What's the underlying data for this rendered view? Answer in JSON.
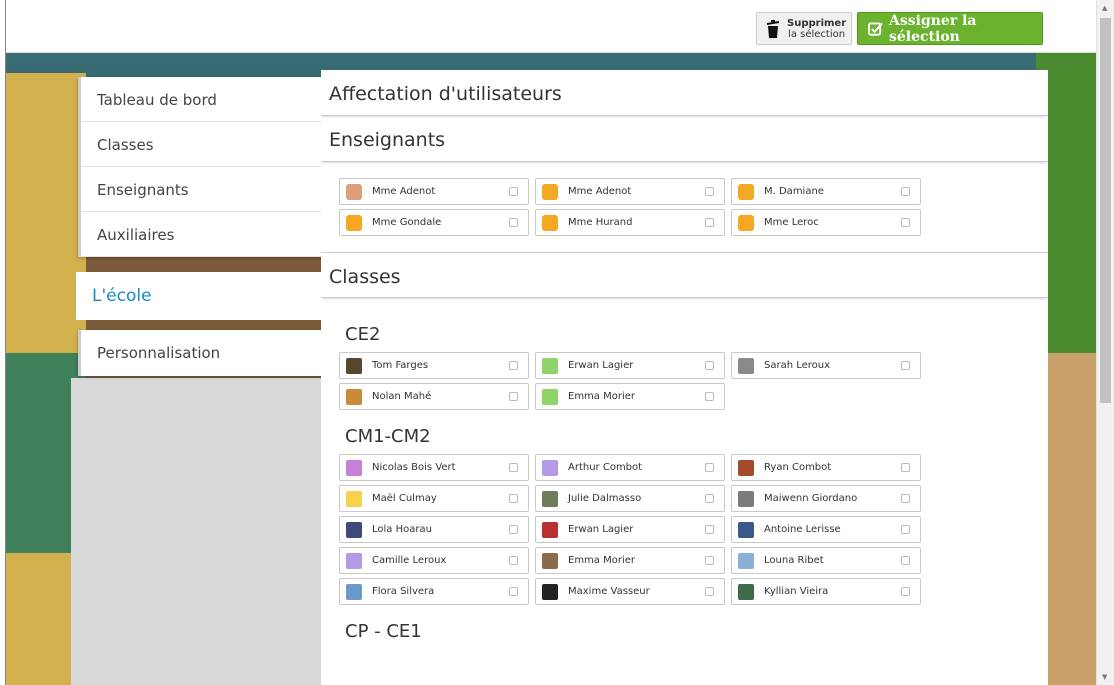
{
  "toolbar": {
    "delete_label_1": "Supprimer",
    "delete_label_2": "la sélection",
    "assign_label": "Assigner la sélection",
    "assign_color": "#6bb32f"
  },
  "sidebar": {
    "items": [
      {
        "label": "Tableau de bord"
      },
      {
        "label": "Classes"
      },
      {
        "label": "Enseignants"
      },
      {
        "label": "Auxiliaires"
      }
    ],
    "active": {
      "label": "L'école",
      "color": "#1a8ac4"
    },
    "perso": {
      "label": "Personnalisation"
    }
  },
  "main": {
    "title": "Affectation d'utilisateurs",
    "teachers_title": "Enseignants",
    "teachers": [
      {
        "name": "Mme Adenot",
        "icon": "avatar-girl"
      },
      {
        "name": "Mme Adenot",
        "icon": "avatar-default"
      },
      {
        "name": "M. Damiane",
        "icon": "avatar-default"
      },
      {
        "name": "Mme Gondale",
        "icon": "avatar-default"
      },
      {
        "name": "Mme Hurand",
        "icon": "avatar-default"
      },
      {
        "name": "Mme Leroc",
        "icon": "avatar-default"
      }
    ],
    "classes_title": "Classes",
    "classes": [
      {
        "name": "CE2",
        "students": [
          {
            "name": "Tom Farges",
            "color": "#5a4630"
          },
          {
            "name": "Erwan Lagier",
            "color": "#8fd46a"
          },
          {
            "name": "Sarah Leroux",
            "color": "#8a8a8a"
          },
          {
            "name": "Nolan Mahé",
            "color": "#c98a3a"
          },
          {
            "name": "Emma Morier",
            "color": "#8fd46a"
          }
        ]
      },
      {
        "name": "CM1-CM2",
        "students": [
          {
            "name": "Nicolas Bois Vert",
            "color": "#c77fd8"
          },
          {
            "name": "Arthur Combot",
            "color": "#b49ae6"
          },
          {
            "name": "Ryan Combot",
            "color": "#a54a2a"
          },
          {
            "name": "Maël Culmay",
            "color": "#f5d24a"
          },
          {
            "name": "Julie Dalmasso",
            "color": "#6f7d5a"
          },
          {
            "name": "Maiwenn Giordano",
            "color": "#7c7c7c"
          },
          {
            "name": "Lola Hoarau",
            "color": "#3d4a7a"
          },
          {
            "name": "Erwan Lagier",
            "color": "#b83030"
          },
          {
            "name": "Antoine Lerisse",
            "color": "#3a5a8a"
          },
          {
            "name": "Camille Leroux",
            "color": "#b49ae6"
          },
          {
            "name": "Emma Morier",
            "color": "#8a6a4a"
          },
          {
            "name": "Louna Ribet",
            "color": "#8ab0d8"
          },
          {
            "name": "Flora Silvera",
            "color": "#6a9ac8"
          },
          {
            "name": "Maxime Vasseur",
            "color": "#222222"
          },
          {
            "name": "Kyllian Vieira",
            "color": "#3f6a4a"
          }
        ]
      },
      {
        "name": "CP - CE1",
        "students": []
      }
    ]
  }
}
